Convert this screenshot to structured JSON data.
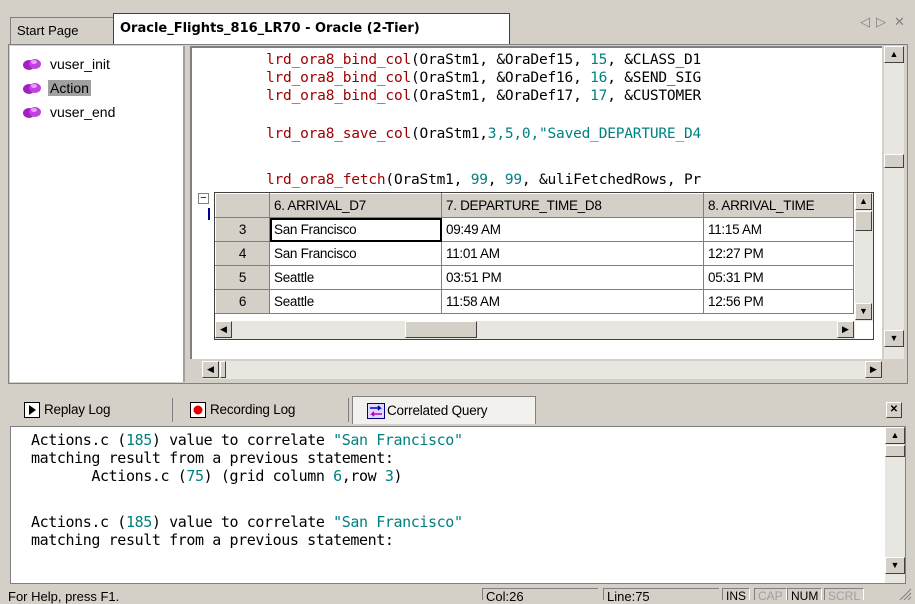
{
  "tabs": {
    "start_label": "Start Page",
    "active_label": "Oracle_Flights_816_LR70 - Oracle (2-Tier)",
    "nav_left": "◁",
    "nav_right": "▷",
    "close": "✕"
  },
  "tree": {
    "items": [
      {
        "label": "vuser_init",
        "icon": "action-gem-icon"
      },
      {
        "label": "Action",
        "icon": "action-gem-icon"
      },
      {
        "label": "vuser_end",
        "icon": "action-gem-icon"
      }
    ],
    "selected": "Action"
  },
  "editor": {
    "lines": [
      {
        "fn": "lrd_ora8_bind_col",
        "pre": "(OraStm1, &OraDef15, ",
        "n": "15",
        "post": ", &CLASS_D1"
      },
      {
        "fn": "lrd_ora8_bind_col",
        "pre": "(OraStm1, &OraDef16, ",
        "n": "16",
        "post": ", &SEND_SIG"
      },
      {
        "fn": "lrd_ora8_bind_col",
        "pre": "(OraStm1, &OraDef17, ",
        "n": "17",
        "post": ", &CUSTOMER"
      },
      {
        "fn": "lrd_ora8_save_col",
        "pre": "(OraStm1,",
        "nums": "3,5,0,",
        "str": "\"Saved_DEPARTURE_D4"
      },
      {
        "fn": "lrd_ora8_fetch",
        "pre": "(OraStm1, ",
        "n": "99",
        "mid": ", ",
        "n2": "99",
        "post": ", &uliFetchedRows, Pr"
      }
    ],
    "collapse_marker": "−"
  },
  "grid": {
    "columns": [
      "",
      "6. ARRIVAL_D7",
      "7. DEPARTURE_TIME_D8",
      "8. ARRIVAL_TIME"
    ],
    "rows": [
      {
        "num": "3",
        "arrival": "San Francisco",
        "departure_time": "09:49 AM",
        "arrival_time": "11:15 AM"
      },
      {
        "num": "4",
        "arrival": "San Francisco",
        "departure_time": "11:01 AM",
        "arrival_time": "12:27 PM"
      },
      {
        "num": "5",
        "arrival": "Seattle",
        "departure_time": "03:51 PM",
        "arrival_time": "05:31 PM"
      },
      {
        "num": "6",
        "arrival": "Seattle",
        "departure_time": "11:58 AM",
        "arrival_time": "12:56 PM"
      }
    ]
  },
  "bottom_tabs": {
    "replay": "Replay Log",
    "recording": "Recording Log",
    "correlated": "Correlated Query",
    "close": "✕"
  },
  "log": {
    "lines": [
      {
        "a": "Actions.c (",
        "n": "185",
        "b": ") value to correlate ",
        "s": "\"San Francisco\""
      },
      {
        "a": "matching result from a previous statement:"
      },
      {
        "a": "       Actions.c (",
        "n": "75",
        "b": ") (grid column ",
        "n2": "6",
        "c": ",row ",
        "n3": "3",
        "d": ")"
      },
      {
        "a": ""
      },
      {
        "a": "Actions.c (",
        "n": "185",
        "b": ") value to correlate ",
        "s": "\"San Francisco\""
      },
      {
        "a": "matching result from a previous statement:"
      }
    ]
  },
  "status": {
    "help": "For Help, press F1.",
    "col": "Col:26",
    "line": "Line:75",
    "ins": "INS",
    "cap": "CAP",
    "num": "NUM",
    "scrl": "SCRL"
  },
  "colors": {
    "function": "#a00000",
    "number": "#008080",
    "string": "#008080",
    "selected_bg": "#a0a0a0"
  }
}
